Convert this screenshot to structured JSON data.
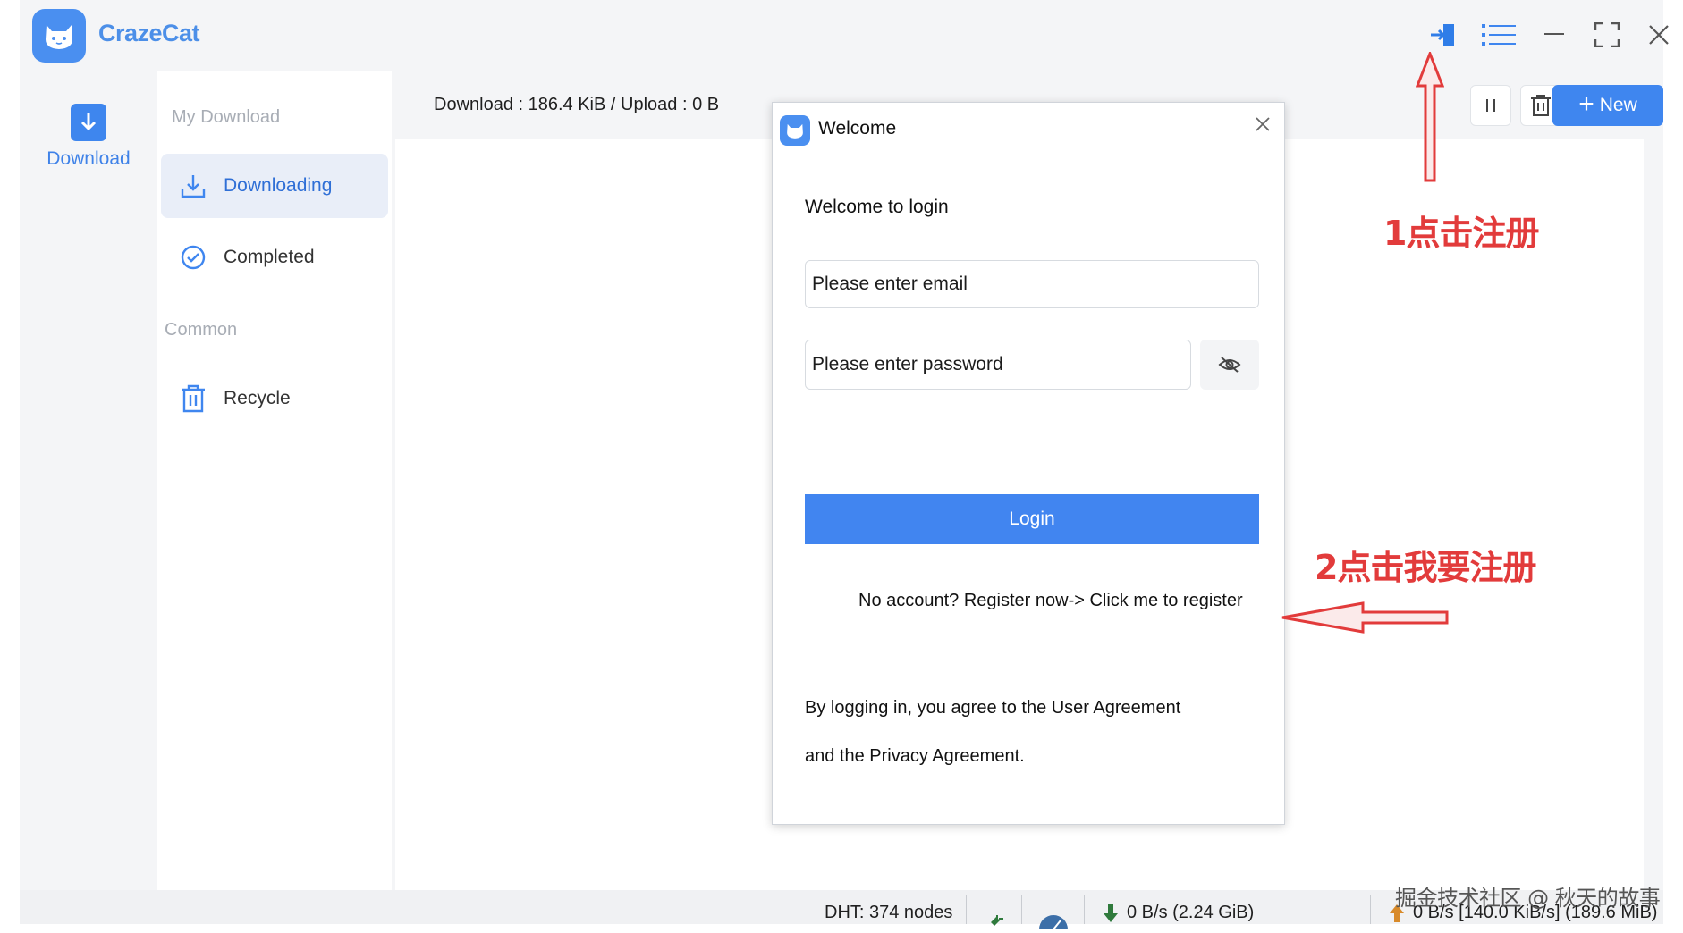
{
  "app": {
    "title": "CrazeCat"
  },
  "rail": {
    "download_label": "Download"
  },
  "menu": {
    "group_my_download": "My Download",
    "group_common": "Common",
    "items": [
      {
        "label": "Downloading",
        "icon": "download-tray-icon",
        "active": true
      },
      {
        "label": "Completed",
        "icon": "check-circle-icon",
        "active": false
      },
      {
        "label": "Recycle",
        "icon": "trash-icon",
        "active": false
      }
    ]
  },
  "toolbar": {
    "stats": "Download : 186.4 KiB / Upload : 0 B",
    "new_label": "New",
    "login_icon": "login-door-icon",
    "list_icon": "list-icon",
    "pause_icon": "pause-icon",
    "delete_icon": "trash-icon"
  },
  "dialog": {
    "title": "Welcome",
    "heading": "Welcome to login",
    "email_placeholder": "Please enter email",
    "password_placeholder": "Please enter password",
    "login_label": "Login",
    "register_text": "No account? Register now-> Click me to register",
    "agree_line1": "By logging in, you agree to the User Agreement",
    "agree_line2": "and the Privacy Agreement."
  },
  "annotations": {
    "step1": "1点击注册",
    "step2": "2点击我要注册",
    "color": "#e23b3b"
  },
  "statusbar": {
    "dht": "DHT: 374 nodes",
    "download_speed": "0 B/s (2.24 GiB)",
    "upload_speed": "0 B/s [140.0 KiB/s] (189.6 MiB)"
  },
  "watermark": "掘金技术社区 @ 秋天的故事",
  "colors": {
    "accent": "#3f86ef",
    "active_bg": "#e9eef8"
  }
}
